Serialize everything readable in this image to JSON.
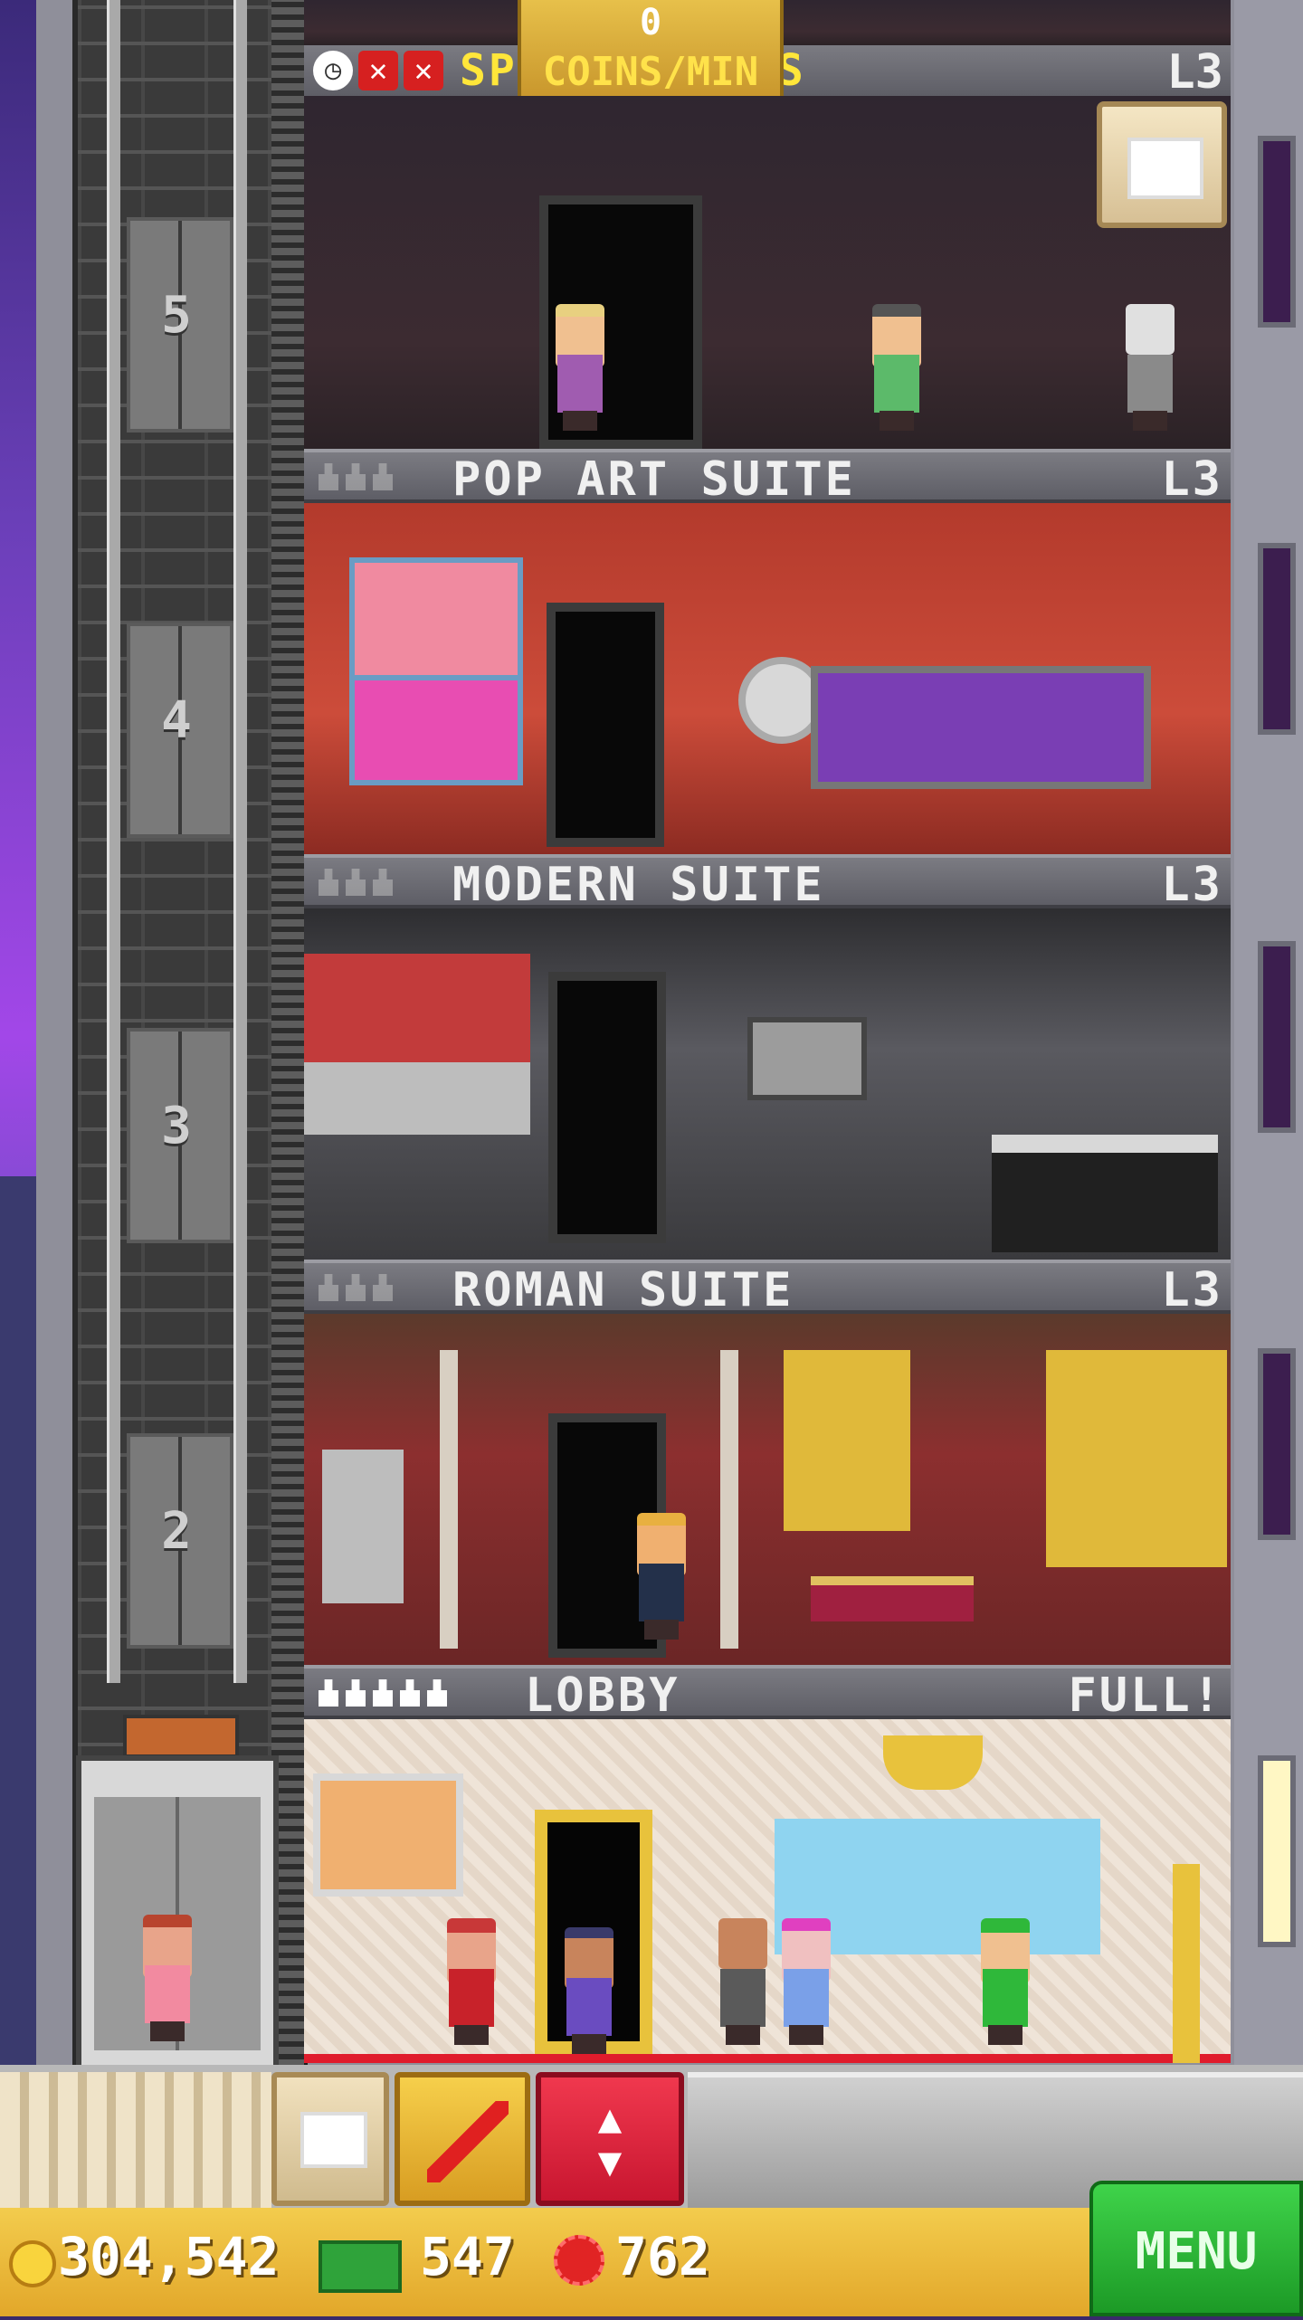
{
  "top": {
    "coins_per_min_value": "0",
    "coins_per_min_label": "COINS/MIN",
    "special_floor_name": "SPOOKY SPOTS",
    "special_floor_level": "L3"
  },
  "floors": [
    {
      "name": "POP ART SUITE",
      "level": "L3",
      "number": "4"
    },
    {
      "name": "MODERN SUITE",
      "level": "L3",
      "number": "3"
    },
    {
      "name": "ROMAN SUITE",
      "level": "L3",
      "number": "2"
    },
    {
      "name": "LOBBY",
      "level": "FULL!",
      "number": ""
    }
  ],
  "elevator_floor_numbers": [
    "5",
    "4",
    "3",
    "2"
  ],
  "status": {
    "coins": "304,542",
    "bux": "547",
    "gems": "762"
  },
  "menu_label": "MENU",
  "colors": {
    "accent_green": "#2fb83a",
    "coin_gold": "#f3cc4d",
    "elevator_red": "#e3213a"
  },
  "icons": [
    "clock-icon",
    "x-icon",
    "crate-icon",
    "rocket-icon",
    "elevator-arrows-icon",
    "coin-icon",
    "bux-icon",
    "gem-icon"
  ]
}
